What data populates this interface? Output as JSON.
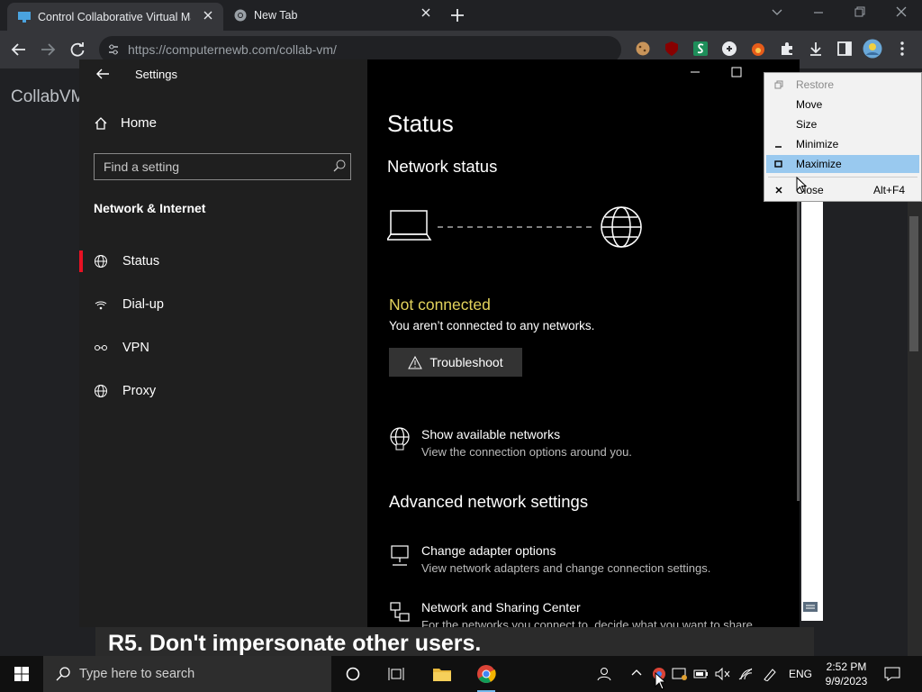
{
  "browser": {
    "tabs": [
      {
        "title": "Control Collaborative Virtual Mac"
      },
      {
        "title": "New Tab"
      }
    ],
    "new_tab_symbol": "+",
    "window_controls": [
      "chevron-down",
      "minimize",
      "restore",
      "close"
    ],
    "url": "https://computernewb.com/collab-vm/",
    "page_heading": "CollabVM"
  },
  "vm": {
    "settings": {
      "window_title": "Settings",
      "home_label": "Home",
      "search_placeholder": "Find a setting",
      "section_title": "Network & Internet",
      "nav": [
        {
          "label": "Status",
          "icon": "globe-status-icon",
          "selected": true
        },
        {
          "label": "Dial-up",
          "icon": "dialup-icon",
          "selected": false
        },
        {
          "label": "VPN",
          "icon": "vpn-icon",
          "selected": false
        },
        {
          "label": "Proxy",
          "icon": "globe-icon",
          "selected": false
        }
      ],
      "content": {
        "heading": "Status",
        "network_status_heading": "Network status",
        "status_text": "Not connected",
        "status_desc": "You aren’t connected to any networks.",
        "troubleshoot_label": "Troubleshoot",
        "show_networks": {
          "title": "Show available networks",
          "sub": "View the connection options around you."
        },
        "advanced_heading": "Advanced network settings",
        "adapter": {
          "title": "Change adapter options",
          "sub": "View network adapters and change connection settings."
        },
        "sharing": {
          "title": "Network and Sharing Center",
          "sub": "For the networks you connect to, decide what you want to share."
        }
      }
    },
    "context_menu": [
      {
        "label": "Restore",
        "glyph": "restore-icon",
        "disabled": true
      },
      {
        "label": "Move"
      },
      {
        "label": "Size"
      },
      {
        "label": "Minimize",
        "glyph": "minimize-icon"
      },
      {
        "label": "Maximize",
        "glyph": "maximize-icon",
        "highlighted": true
      },
      {
        "label": "Close",
        "glyph": "close-icon",
        "accelerator": "Alt+F4"
      }
    ],
    "rule_banner": "R5. Don't impersonate other users.",
    "taskbar": {
      "search_placeholder": "Type here to search",
      "language": "ENG",
      "time": "2:52 PM",
      "date": "9/9/2023"
    }
  },
  "colors": {
    "accent_red": "#e81123",
    "status_yellow": "#e3d35c",
    "menu_highlight": "#99c9ef"
  }
}
